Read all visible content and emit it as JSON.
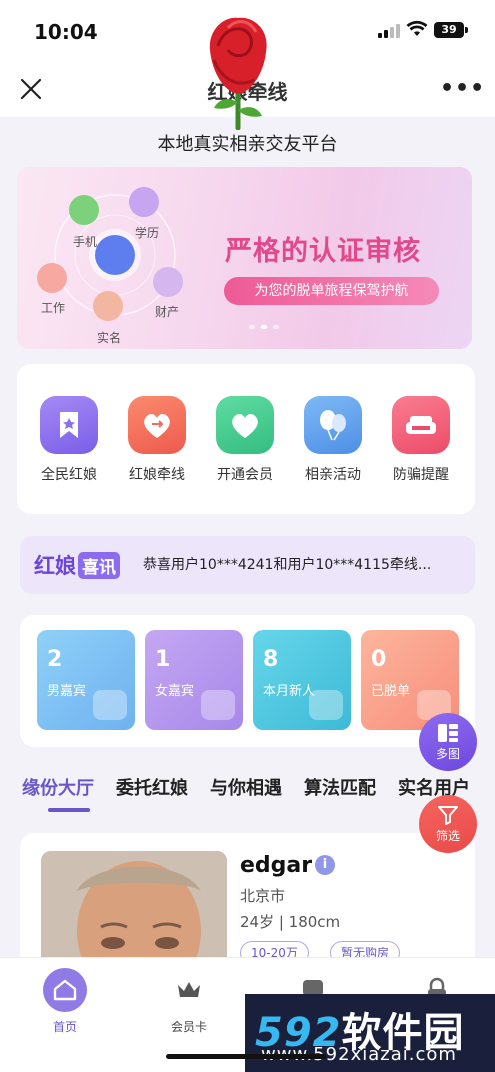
{
  "status_bar": {
    "time": "10:04",
    "battery": "39"
  },
  "nav": {
    "title": "红娘牵线",
    "more_label": "•••"
  },
  "tagline": "本地真实相亲交友平台",
  "banner": {
    "nodes": [
      "手机",
      "学历",
      "工作",
      "财产",
      "实名"
    ],
    "title": "严格的认证审核",
    "subtitle": "为您的脱单旅程保驾护航"
  },
  "entries": [
    {
      "label": "全民红娘",
      "icon": "bookmark-star-icon",
      "color": "#8a6ff0"
    },
    {
      "label": "红娘牵线",
      "icon": "heart-link-icon",
      "color": "#f36b5c"
    },
    {
      "label": "开通会员",
      "icon": "heart-icon",
      "color": "#43c98f"
    },
    {
      "label": "相亲活动",
      "icon": "balloons-icon",
      "color": "#5da2ee"
    },
    {
      "label": "防骗提醒",
      "icon": "sofa-icon",
      "color": "#f25a74"
    }
  ],
  "notice": {
    "logo_main": "红娘",
    "logo_tag": "喜讯",
    "text": "恭喜用户10***4241和用户10***4115牵线..."
  },
  "stats": [
    {
      "value": "2",
      "label": "男嘉宾"
    },
    {
      "value": "1",
      "label": "女嘉宾"
    },
    {
      "value": "8",
      "label": "本月新人"
    },
    {
      "value": "0",
      "label": "已脱单"
    }
  ],
  "fab": {
    "grid_label": "多图",
    "filter_label": "筛选"
  },
  "tabs": [
    "缘份大厅",
    "委托红娘",
    "与你相遇",
    "算法匹配",
    "实名用户"
  ],
  "active_tab": "缘份大厅",
  "profile": {
    "name": "edgar",
    "verified_badge": "i",
    "city": "北京市",
    "meta": "24岁 | 180cm",
    "tags": [
      "10-20万",
      "暂无购房"
    ]
  },
  "tabbar": [
    {
      "label": "首页",
      "icon": "home-icon",
      "active": true
    },
    {
      "label": "会员卡",
      "icon": "crown-icon",
      "active": false
    },
    {
      "label": "",
      "icon": "message-icon",
      "active": false
    },
    {
      "label": "",
      "icon": "lock-icon",
      "active": false
    }
  ],
  "watermark": {
    "brand_num": "592",
    "brand_text": "软件园",
    "url": "www.592xiazai.com"
  }
}
